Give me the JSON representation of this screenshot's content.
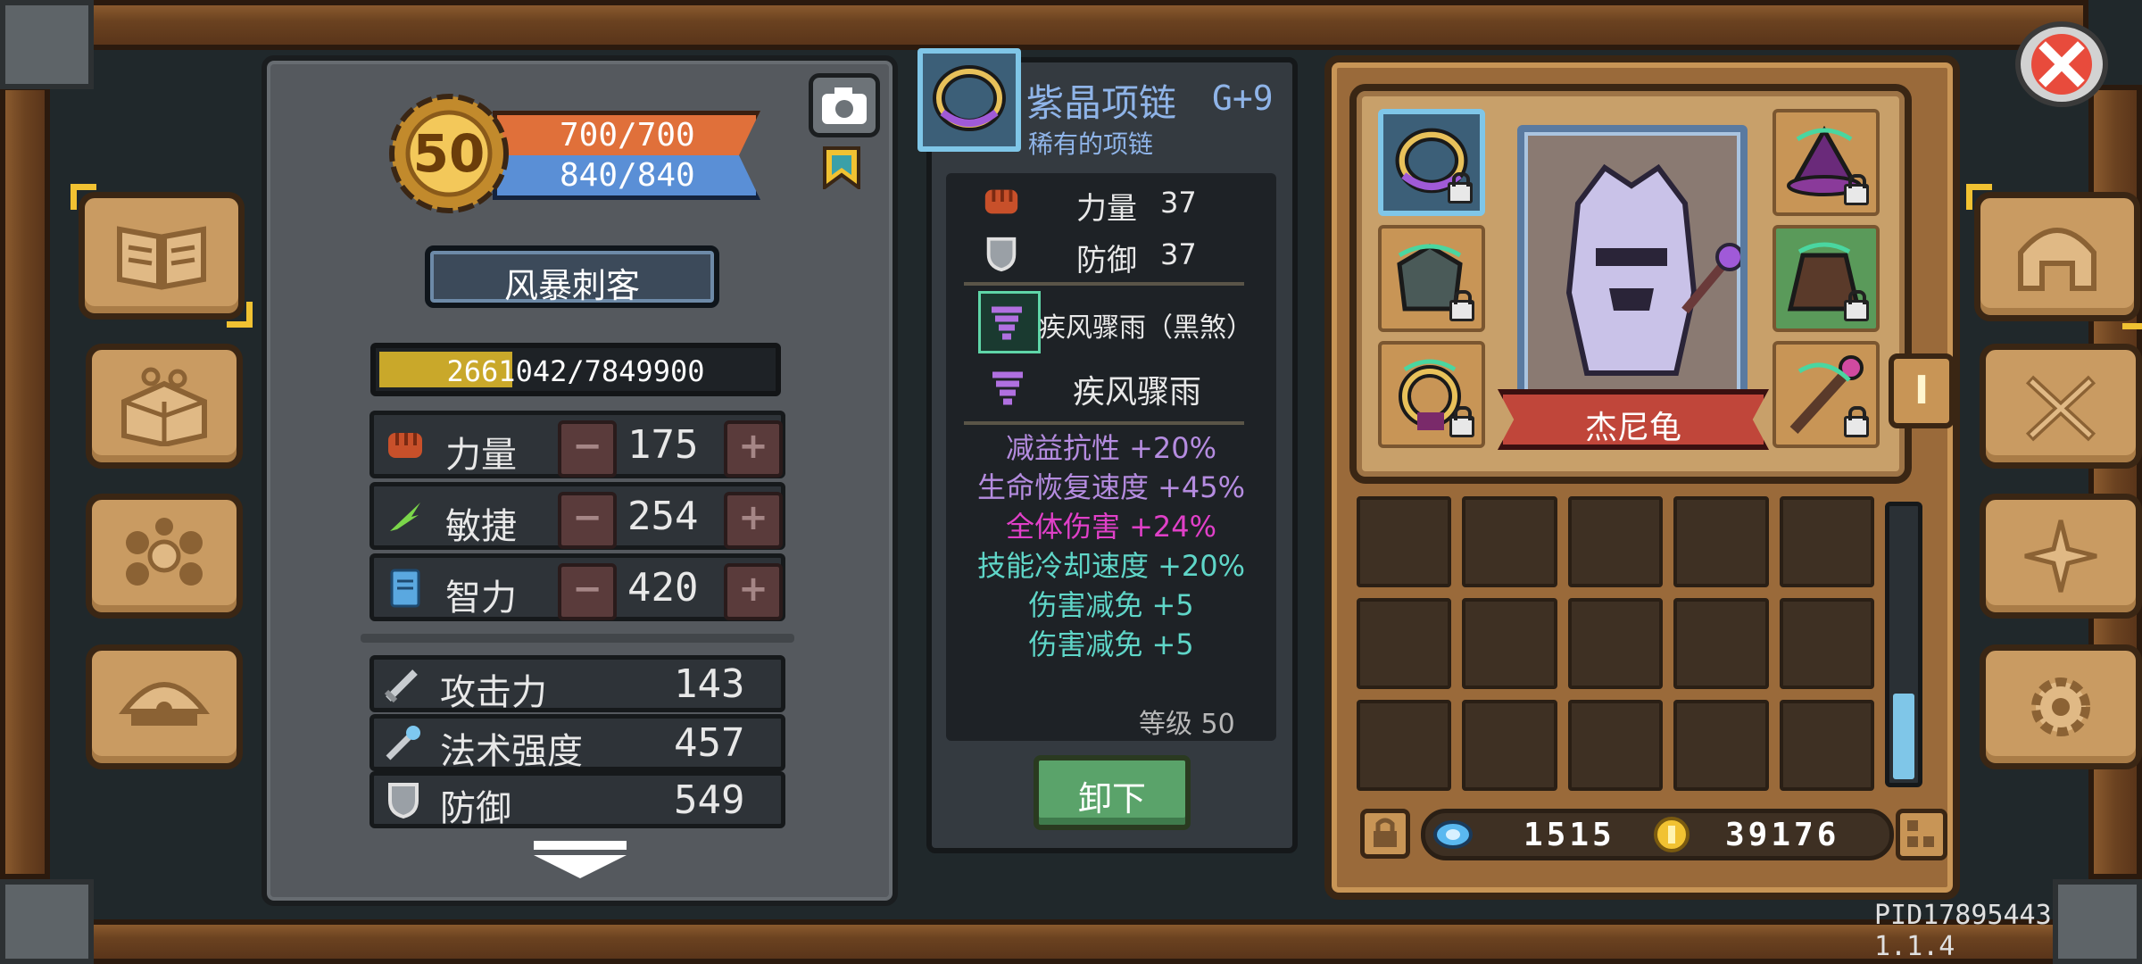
{
  "hero": {
    "level": "50",
    "hp": "700/700",
    "mp": "840/840",
    "class_name": "风暴刺客",
    "exp": "2661042/7849900",
    "exp_fraction": 0.339,
    "attributes": [
      {
        "name": "力量",
        "value": "175",
        "icon": "fist-icon"
      },
      {
        "name": "敏捷",
        "value": "254",
        "icon": "feather-icon"
      },
      {
        "name": "智力",
        "value": "420",
        "icon": "book-icon"
      }
    ],
    "derived": [
      {
        "name": "攻击力",
        "value": "143",
        "icon": "sword-icon"
      },
      {
        "name": "法术强度",
        "value": "457",
        "icon": "wand-icon"
      },
      {
        "name": "防御",
        "value": "549",
        "icon": "shield-icon"
      }
    ],
    "minus": "−",
    "plus": "+"
  },
  "item": {
    "name": "紫晶项链",
    "enhance": "G+9",
    "rarity_text": "稀有的项链",
    "base_stats": [
      {
        "name": "力量",
        "value": "37",
        "icon": "fist-icon"
      },
      {
        "name": "防御",
        "value": "37",
        "icon": "shield-icon"
      }
    ],
    "skills": [
      {
        "name": "疾风骤雨（黑煞）"
      },
      {
        "name": "疾风骤雨"
      }
    ],
    "affixes": [
      {
        "text": "减益抗性 +20%",
        "color": "#b58ce0"
      },
      {
        "text": "生命恢复速度 +45%",
        "color": "#b58ce0"
      },
      {
        "text": "全体伤害 +24%",
        "color": "#e040c8"
      },
      {
        "text": "技能冷却速度 +20%",
        "color": "#5fd6c8"
      },
      {
        "text": "伤害减免 +5",
        "color": "#5fd6c8"
      },
      {
        "text": "伤害减免 +5",
        "color": "#5fd6c8"
      }
    ],
    "level_text": "等级 50",
    "unequip_label": "卸下"
  },
  "equipment": {
    "character_name": "杰尼龟",
    "side_badge": "I",
    "currency": {
      "gems": "1515",
      "gold": "39176"
    }
  },
  "footer": {
    "pid": "PID17895443 1.1.4"
  },
  "colors": {
    "hp": "#e0703a",
    "mp": "#5a8fd6",
    "gold": "#f1c232",
    "accent_green": "#5aa36a"
  }
}
